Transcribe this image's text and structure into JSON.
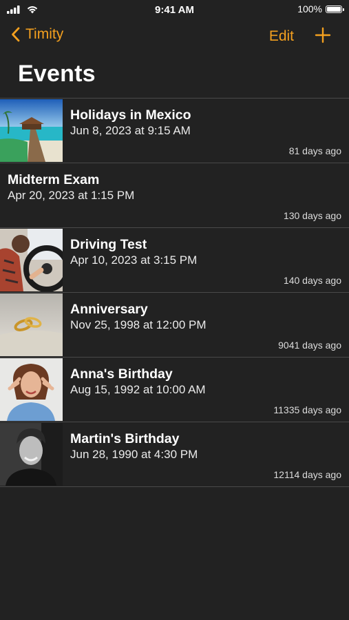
{
  "status_bar": {
    "time": "9:41 AM",
    "battery_text": "100%",
    "battery_level": 1.0,
    "icons": [
      "signal-bars-icon",
      "wifi-icon",
      "battery-icon"
    ]
  },
  "nav": {
    "back_label": "Timity",
    "edit_label": "Edit",
    "add_icon": "plus-icon",
    "accent_color": "#f4a01f"
  },
  "page": {
    "title": "Events"
  },
  "events": [
    {
      "title": "Holidays in Mexico",
      "date": "Jun 8, 2023 at 9:15 AM",
      "ago": "81 days ago",
      "image": "beach-bungalow-photo"
    },
    {
      "title": "Midterm Exam",
      "date": "Apr 20, 2023 at 1:15 PM",
      "ago": "130 days ago",
      "image": null
    },
    {
      "title": "Driving Test",
      "date": "Apr 10, 2023 at 3:15 PM",
      "ago": "140 days ago",
      "image": "steering-wheel-photo"
    },
    {
      "title": "Anniversary",
      "date": "Nov 25, 1998 at 12:00 PM",
      "ago": "9041 days ago",
      "image": "wedding-rings-photo"
    },
    {
      "title": "Anna's Birthday",
      "date": "Aug 15, 1992 at 10:00 AM",
      "ago": "11335 days ago",
      "image": "woman-portrait-photo"
    },
    {
      "title": "Martin's Birthday",
      "date": "Jun 28, 1990 at 4:30 PM",
      "ago": "12114 days ago",
      "image": "man-portrait-photo"
    }
  ]
}
